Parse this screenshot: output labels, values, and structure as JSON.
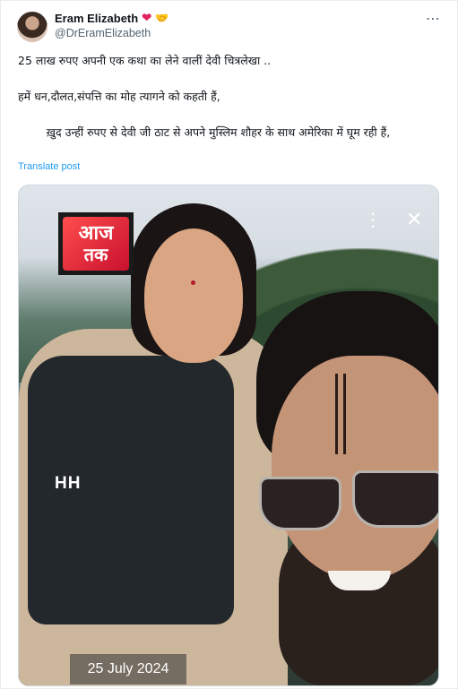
{
  "author": {
    "name": "Eram Elizabeth",
    "handle": "@DrEramElizabeth",
    "badges": [
      "red-heart-icon",
      "handshake-emoji-icon"
    ]
  },
  "post": {
    "line1": "25 लाख रुपए अपनी एक कथा का लेने वालीं देवी चित्रलेखा ..",
    "line2": "हमें धन,दौलत,संपत्ति का मोह त्यागने को कहती हैं,",
    "line3": "        ख़ुद उन्हीं रुपए से देवी जी ठाट से अपने मुस्लिम शौहर के साथ अमेरिका में घूम रही हैं,",
    "translate_label": "Translate post"
  },
  "media": {
    "logo_line1": "आज",
    "logo_line2": "तक",
    "vest_text": "HH",
    "date_label": "25 July 2024",
    "more_glyph": "⋮",
    "close_glyph": "✕"
  },
  "menu": {
    "more_glyph": "⋯"
  },
  "colors": {
    "link": "#1d9bf0",
    "muted": "#536471",
    "heart": "#e0245e"
  }
}
